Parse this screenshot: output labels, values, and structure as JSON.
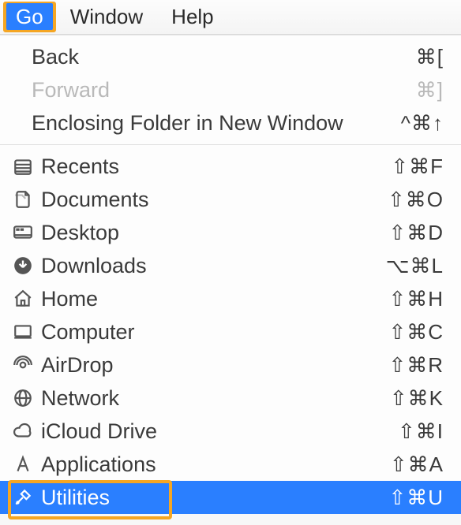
{
  "menubar": {
    "go": "Go",
    "window": "Window",
    "help": "Help"
  },
  "menu": {
    "back": {
      "label": "Back",
      "shortcut": "⌘["
    },
    "forward": {
      "label": "Forward",
      "shortcut": "⌘]"
    },
    "enclosing": {
      "label": "Enclosing Folder in New Window",
      "shortcut": "^⌘↑"
    },
    "recents": {
      "label": "Recents",
      "shortcut": "⇧⌘F"
    },
    "documents": {
      "label": "Documents",
      "shortcut": "⇧⌘O"
    },
    "desktop": {
      "label": "Desktop",
      "shortcut": "⇧⌘D"
    },
    "downloads": {
      "label": "Downloads",
      "shortcut": "⌥⌘L"
    },
    "home": {
      "label": "Home",
      "shortcut": "⇧⌘H"
    },
    "computer": {
      "label": "Computer",
      "shortcut": "⇧⌘C"
    },
    "airdrop": {
      "label": "AirDrop",
      "shortcut": "⇧⌘R"
    },
    "network": {
      "label": "Network",
      "shortcut": "⇧⌘K"
    },
    "icloud": {
      "label": "iCloud Drive",
      "shortcut": "⇧⌘I"
    },
    "applications": {
      "label": "Applications",
      "shortcut": "⇧⌘A"
    },
    "utilities": {
      "label": "Utilities",
      "shortcut": "⇧⌘U"
    }
  }
}
